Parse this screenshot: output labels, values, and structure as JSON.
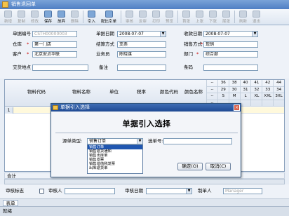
{
  "window": {
    "title": "销售退回单"
  },
  "toolbar": {
    "items": [
      {
        "label": "新增",
        "enabled": false
      },
      {
        "label": "复制",
        "enabled": false
      },
      {
        "label": "修改",
        "enabled": false
      },
      {
        "label": "保存",
        "enabled": true
      },
      {
        "label": "放弃",
        "enabled": true
      },
      {
        "label": "删除",
        "enabled": false
      },
      {
        "label": "引入",
        "enabled": true
      },
      {
        "label": "配比引单",
        "enabled": true
      },
      {
        "label": "审核",
        "enabled": false
      },
      {
        "label": "反审",
        "enabled": false
      },
      {
        "label": "打印",
        "enabled": false
      },
      {
        "label": "预览",
        "enabled": false
      },
      {
        "label": "首张",
        "enabled": false
      },
      {
        "label": "上张",
        "enabled": false
      },
      {
        "label": "下张",
        "enabled": false
      },
      {
        "label": "尾张",
        "enabled": false
      },
      {
        "label": "刷新",
        "enabled": false
      },
      {
        "label": "退出",
        "enabled": false
      }
    ]
  },
  "form": {
    "doc_no_label": "单据编号",
    "doc_no_value": "CSTH00000003",
    "doc_date_label": "单据日期",
    "doc_date_value": "2008-07-07",
    "receipt_date_label": "收款日期",
    "receipt_date_value": "2008-07-07",
    "warehouse_label": "仓库",
    "warehouse_value": "第一门店",
    "settle_label": "结算方式",
    "settle_value": "支票",
    "sales_mode_label": "销售方式",
    "sales_mode_value": "现销",
    "customer_label": "客户",
    "customer_value": "北京安贞华联",
    "salesman_label": "业务员",
    "salesman_value": "陈晓谋",
    "dept_label": "部门",
    "dept_value": "综合部",
    "delivery_label": "交货地点",
    "delivery_value": "",
    "remark_label": "备注",
    "remark_value": "",
    "barcode_label": "条码",
    "barcode_value": ""
  },
  "grid": {
    "columns": [
      "物料代码",
      "物料名称",
      "单位",
      "税率",
      "颜色代码",
      "颜色名称"
    ],
    "size_rows": [
      [
        "--",
        "36",
        "38",
        "40",
        "41",
        "42",
        "44"
      ],
      [
        "--",
        "29",
        "30",
        "31",
        "32",
        "33",
        "34"
      ],
      [
        "--",
        "S",
        "M",
        "L",
        "XL",
        "XXL",
        "3XL"
      ],
      [
        "--",
        "",
        "",
        "",
        "",
        "",
        ""
      ]
    ],
    "row_number": "1",
    "sum_label": "合计"
  },
  "footer": {
    "audit_flag_label": "审核标志",
    "auditor_label": "审核人",
    "audit_date_label": "审核日期",
    "maker_label": "制单人",
    "maker_value": "Manager",
    "tab_label": "表单",
    "status_text": "就绪"
  },
  "dialog": {
    "title": "单据引入选择",
    "heading": "单据引入选择",
    "source_type_label": "源单类型:",
    "source_type_value": "销售订单",
    "doc_no_label": "选单号:",
    "options": [
      "销售订单",
      "销售退货通知",
      "销售出库单",
      "销售发票",
      "销售增值税发票",
      "出库退货单"
    ],
    "ok_label": "确定(O)",
    "cancel_label": "取消(C)"
  }
}
